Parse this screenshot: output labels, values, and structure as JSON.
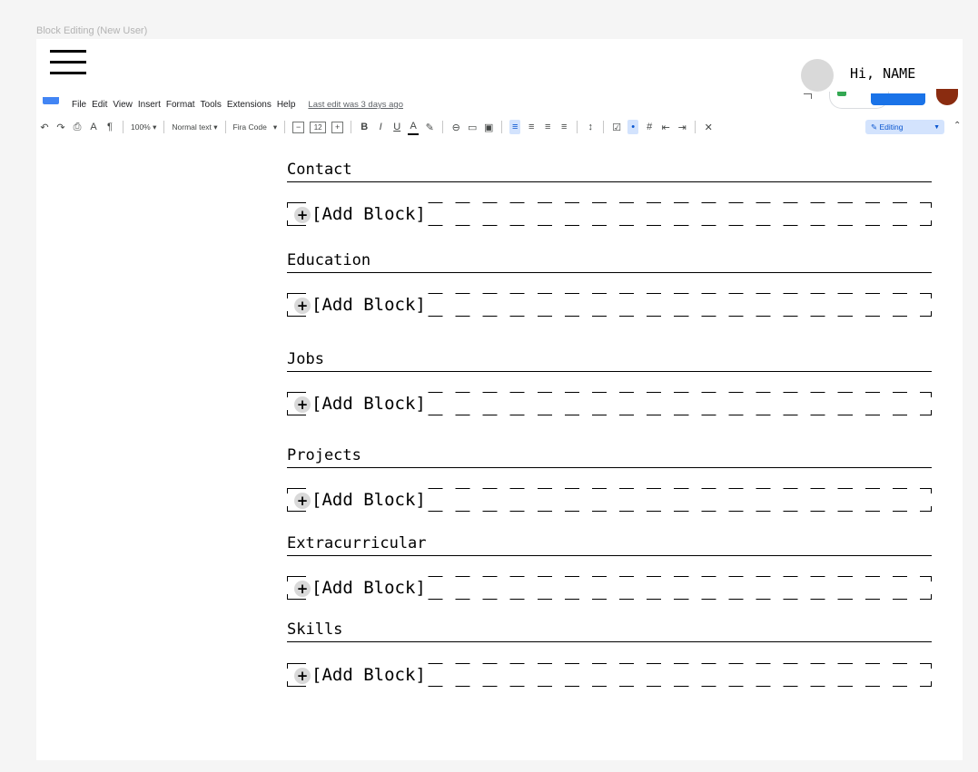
{
  "frame_label": "Block Editing (New User)",
  "header": {
    "greeting": "Hi, NAME"
  },
  "docs_menu": {
    "items": [
      "File",
      "Edit",
      "View",
      "Insert",
      "Format",
      "Tools",
      "Extensions",
      "Help"
    ],
    "last_edit": "Last edit was 3 days ago"
  },
  "docs_toolbar": {
    "zoom": "100%",
    "style": "Normal text",
    "font": "Fira Code",
    "font_size": "12",
    "mode": "Editing"
  },
  "sections": [
    {
      "title": "Contact",
      "add_label": "[Add Block]"
    },
    {
      "title": "Education",
      "add_label": "[Add Block]"
    },
    {
      "title": "Jobs",
      "add_label": "[Add Block]"
    },
    {
      "title": "Projects",
      "add_label": "[Add Block]"
    },
    {
      "title": "Extracurricular",
      "add_label": "[Add Block]"
    },
    {
      "title": "Skills",
      "add_label": "[Add Block]"
    }
  ],
  "colors": {
    "accent": "#1a73e8",
    "avatar": "#d9d9d9",
    "editing_bg": "#d3e3fd"
  }
}
